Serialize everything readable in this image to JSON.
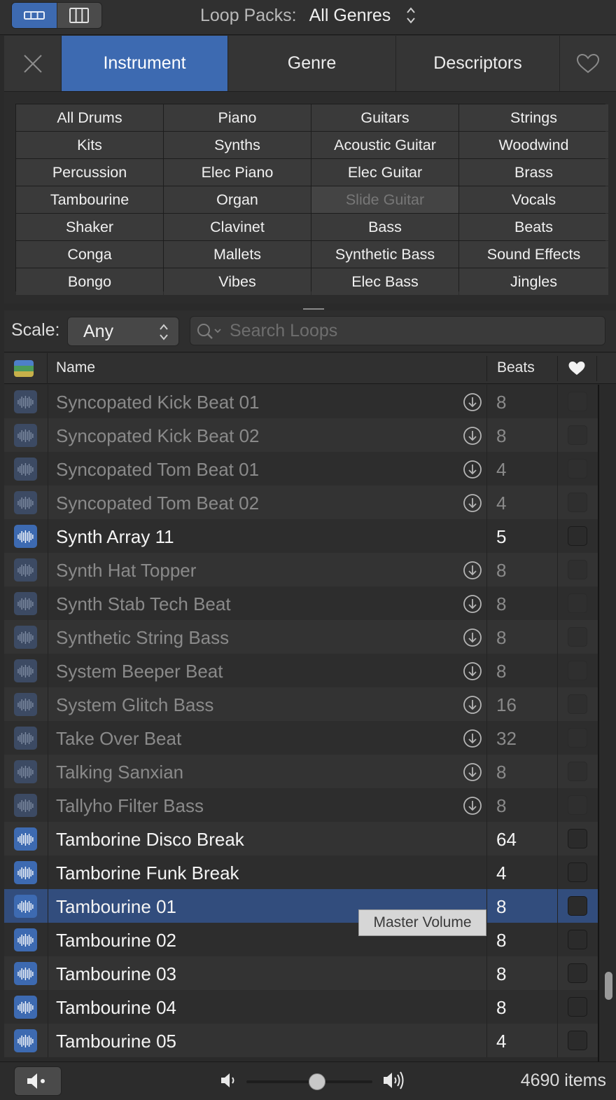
{
  "topbar": {
    "loop_packs_label": "Loop Packs:",
    "loop_packs_value": "All Genres"
  },
  "tabs": {
    "instrument": "Instrument",
    "genre": "Genre",
    "descriptors": "Descriptors"
  },
  "keywords": [
    [
      "All Drums",
      "Piano",
      "Guitars",
      "Strings"
    ],
    [
      "Kits",
      "Synths",
      "Acoustic Guitar",
      "Woodwind"
    ],
    [
      "Percussion",
      "Elec Piano",
      "Elec Guitar",
      "Brass"
    ],
    [
      "Tambourine",
      "Organ",
      "Slide Guitar",
      "Vocals"
    ],
    [
      "Shaker",
      "Clavinet",
      "Bass",
      "Beats"
    ],
    [
      "Conga",
      "Mallets",
      "Synthetic Bass",
      "Sound Effects"
    ],
    [
      "Bongo",
      "Vibes",
      "Elec Bass",
      "Jingles"
    ]
  ],
  "keywords_disabled": [
    "Slide Guitar"
  ],
  "scale": {
    "label": "Scale:",
    "value": "Any"
  },
  "search": {
    "placeholder": "Search Loops"
  },
  "table": {
    "col_name": "Name",
    "col_beats": "Beats",
    "rows": [
      {
        "name": "Syncopated Kick Beat 01",
        "beats": "8",
        "downloaded": false
      },
      {
        "name": "Syncopated Kick Beat 02",
        "beats": "8",
        "downloaded": false
      },
      {
        "name": "Syncopated Tom Beat 01",
        "beats": "4",
        "downloaded": false
      },
      {
        "name": "Syncopated Tom Beat 02",
        "beats": "4",
        "downloaded": false
      },
      {
        "name": "Synth Array 11",
        "beats": "5",
        "downloaded": true
      },
      {
        "name": "Synth Hat Topper",
        "beats": "8",
        "downloaded": false
      },
      {
        "name": "Synth Stab Tech Beat",
        "beats": "8",
        "downloaded": false
      },
      {
        "name": "Synthetic String Bass",
        "beats": "8",
        "downloaded": false
      },
      {
        "name": "System Beeper Beat",
        "beats": "8",
        "downloaded": false
      },
      {
        "name": "System Glitch Bass",
        "beats": "16",
        "downloaded": false
      },
      {
        "name": "Take Over Beat",
        "beats": "32",
        "downloaded": false
      },
      {
        "name": "Talking Sanxian",
        "beats": "8",
        "downloaded": false
      },
      {
        "name": "Tallyho Filter Bass",
        "beats": "8",
        "downloaded": false
      },
      {
        "name": "Tamborine Disco Break",
        "beats": "64",
        "downloaded": true
      },
      {
        "name": "Tamborine Funk Break",
        "beats": "4",
        "downloaded": true
      },
      {
        "name": "Tambourine 01",
        "beats": "8",
        "downloaded": true,
        "selected": true
      },
      {
        "name": "Tambourine 02",
        "beats": "8",
        "downloaded": true
      },
      {
        "name": "Tambourine 03",
        "beats": "8",
        "downloaded": true
      },
      {
        "name": "Tambourine 04",
        "beats": "8",
        "downloaded": true
      },
      {
        "name": "Tambourine 05",
        "beats": "4",
        "downloaded": true
      }
    ]
  },
  "tooltip": {
    "text": "Master Volume"
  },
  "footer": {
    "items_count": "4690 items",
    "volume_level": 0.57
  },
  "colors": {
    "accent": "#3d6ab1",
    "selected_row": "#324d7d",
    "background": "#2a2a2a"
  }
}
